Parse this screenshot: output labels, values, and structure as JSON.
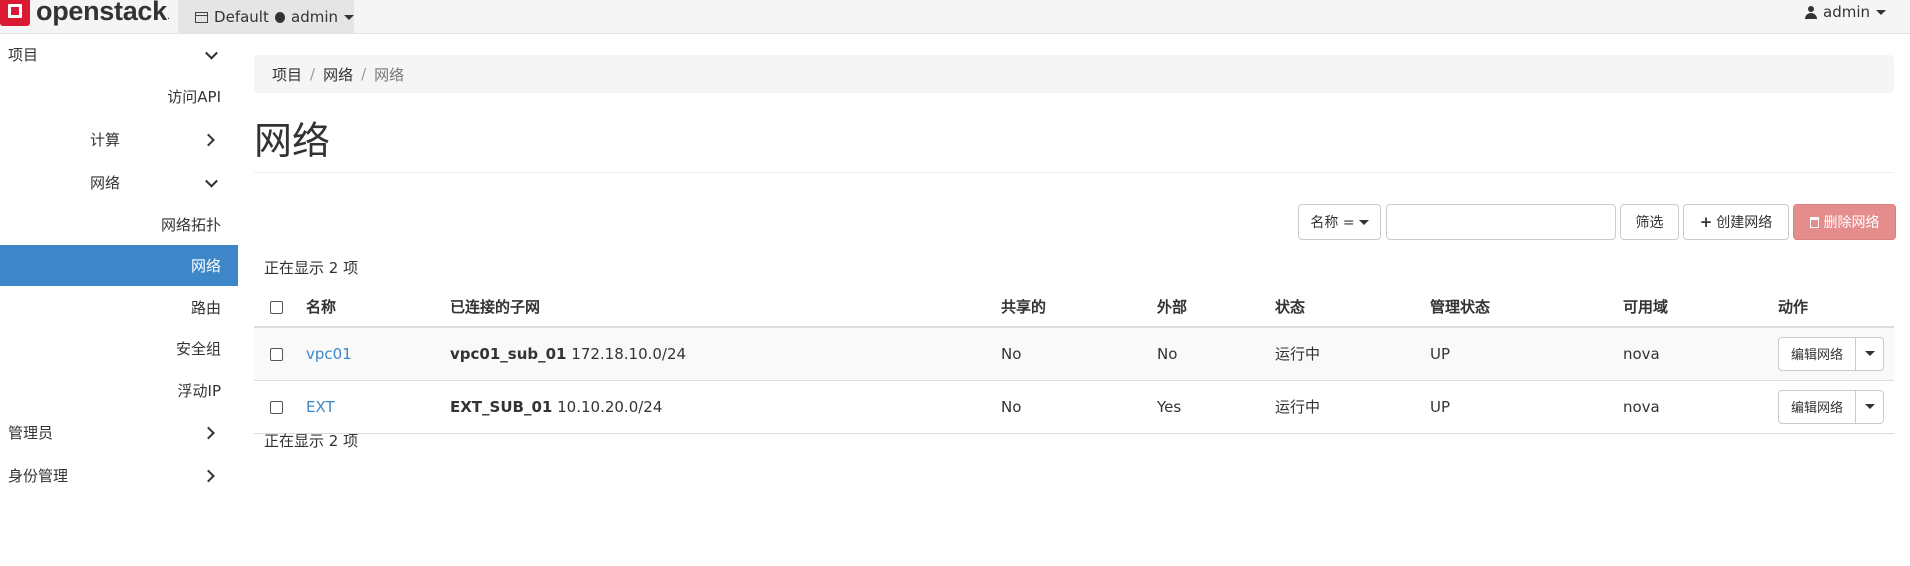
{
  "brand": {
    "name": "openstack",
    "reg": "."
  },
  "topbar": {
    "domain": "Default",
    "project": "admin",
    "user": "admin"
  },
  "sidebar": {
    "items": [
      {
        "label": "项目"
      },
      {
        "label": "访问API"
      },
      {
        "label": "计算"
      },
      {
        "label": "网络"
      },
      {
        "label": "网络拓扑"
      },
      {
        "label": "网络"
      },
      {
        "label": "路由"
      },
      {
        "label": "安全组"
      },
      {
        "label": "浮动IP"
      },
      {
        "label": "管理员"
      },
      {
        "label": "身份管理"
      }
    ]
  },
  "breadcrumb": {
    "items": [
      "项目",
      "网络",
      "网络"
    ]
  },
  "page": {
    "title": "网络"
  },
  "toolbar": {
    "filter_field_label": "名称 =",
    "filter_value": "",
    "filter_button": "筛选",
    "create_button": "创建网络",
    "delete_button": "删除网络"
  },
  "table": {
    "count_top": "正在显示 2 项",
    "count_bottom": "正在显示 2 项",
    "headers": [
      "名称",
      "已连接的子网",
      "共享的",
      "外部",
      "状态",
      "管理状态",
      "可用域",
      "动作"
    ],
    "rows": [
      {
        "name": "vpc01",
        "subnet_name": "vpc01_sub_01",
        "subnet_cidr": "172.18.10.0/24",
        "shared": "No",
        "external": "No",
        "status": "运行中",
        "admin_state": "UP",
        "az": "nova",
        "action": "编辑网络"
      },
      {
        "name": "EXT",
        "subnet_name": "EXT_SUB_01",
        "subnet_cidr": "10.10.20.0/24",
        "shared": "No",
        "external": "Yes",
        "status": "运行中",
        "admin_state": "UP",
        "az": "nova",
        "action": "编辑网络"
      }
    ]
  }
}
